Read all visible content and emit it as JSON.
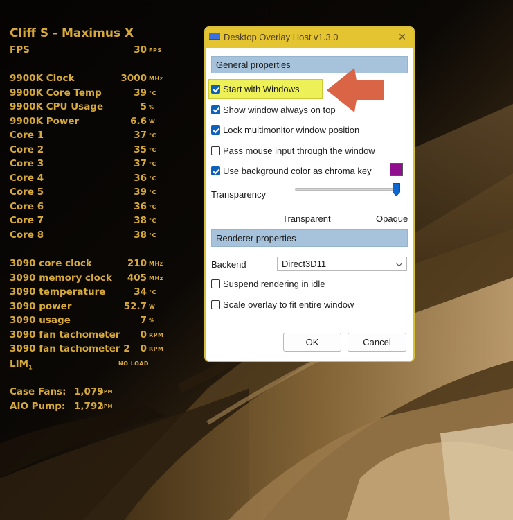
{
  "osd": {
    "title": "Cliff S - Maximus X",
    "fps": {
      "label": "FPS",
      "value": "30",
      "unit": "FPS"
    },
    "rows_a": [
      {
        "label": "9900K Clock",
        "value": "3000",
        "unit": "MHz"
      },
      {
        "label": "9900K Core Temp",
        "value": "39",
        "unit": "°C"
      },
      {
        "label": "9900K CPU Usage",
        "value": "5",
        "unit": "%"
      },
      {
        "label": "9900K Power",
        "value": "6.6",
        "unit": "W"
      },
      {
        "label": "Core 1",
        "value": "37",
        "unit": "°C"
      },
      {
        "label": "Core 2",
        "value": "35",
        "unit": "°C"
      },
      {
        "label": "Core 3",
        "value": "37",
        "unit": "°C"
      },
      {
        "label": "Core 4",
        "value": "36",
        "unit": "°C"
      },
      {
        "label": "Core 5",
        "value": "39",
        "unit": "°C"
      },
      {
        "label": "Core 6",
        "value": "36",
        "unit": "°C"
      },
      {
        "label": "Core 7",
        "value": "38",
        "unit": "°C"
      },
      {
        "label": "Core 8",
        "value": "38",
        "unit": "°C"
      }
    ],
    "rows_b": [
      {
        "label": "3090 core clock",
        "value": "210",
        "unit": "MHz"
      },
      {
        "label": "3090 memory clock",
        "value": "405",
        "unit": "MHz"
      },
      {
        "label": "3090 temperature",
        "value": "34",
        "unit": "°C"
      },
      {
        "label": "3090 power",
        "value": "52.7",
        "unit": "W"
      },
      {
        "label": "3090 usage",
        "value": "7",
        "unit": "%"
      },
      {
        "label": "3090 fan tachometer",
        "value": "0",
        "unit": "RPM"
      },
      {
        "label": "3090 fan tachometer 2",
        "value": "0",
        "unit": "RPM"
      }
    ],
    "lim": {
      "label": "LIM",
      "sub": "1",
      "value": "NO LOAD"
    },
    "fans": [
      {
        "label": "Case Fans:",
        "value": "1,079",
        "unit": "RPM"
      },
      {
        "label": "AIO Pump:",
        "value": "1,792",
        "unit": "RPM"
      }
    ]
  },
  "dialog": {
    "title": "Desktop Overlay Host v1.3.0",
    "close_glyph": "✕",
    "general_header": "General properties",
    "options": [
      {
        "label": "Start with Windows",
        "checked": true,
        "highlighted": true
      },
      {
        "label": "Show window always on top",
        "checked": true
      },
      {
        "label": "Lock multimonitor window position",
        "checked": true
      },
      {
        "label": "Pass mouse input through the window",
        "checked": false
      },
      {
        "label": "Use background color as chroma key",
        "checked": true
      }
    ],
    "chroma_color": "#8f0f8e",
    "transparency": {
      "label": "Transparency",
      "min_label": "Transparent",
      "max_label": "Opaque",
      "value": 1.0
    },
    "renderer_header": "Renderer properties",
    "backend": {
      "label": "Backend",
      "selected": "Direct3D11"
    },
    "renderer_options": [
      {
        "label": "Suspend rendering in idle",
        "checked": false
      },
      {
        "label": "Scale overlay to fit entire window",
        "checked": false
      }
    ],
    "ok_label": "OK",
    "cancel_label": "Cancel"
  },
  "colors": {
    "osd_text": "#d7a93a",
    "title_bar": "#e4c431",
    "section_header": "#a7c3dc",
    "highlight": "#eef058",
    "arrow": "#d96446",
    "checkbox_checked": "#0f5fbd"
  },
  "annotation": {
    "icon": "left-arrow-icon"
  }
}
